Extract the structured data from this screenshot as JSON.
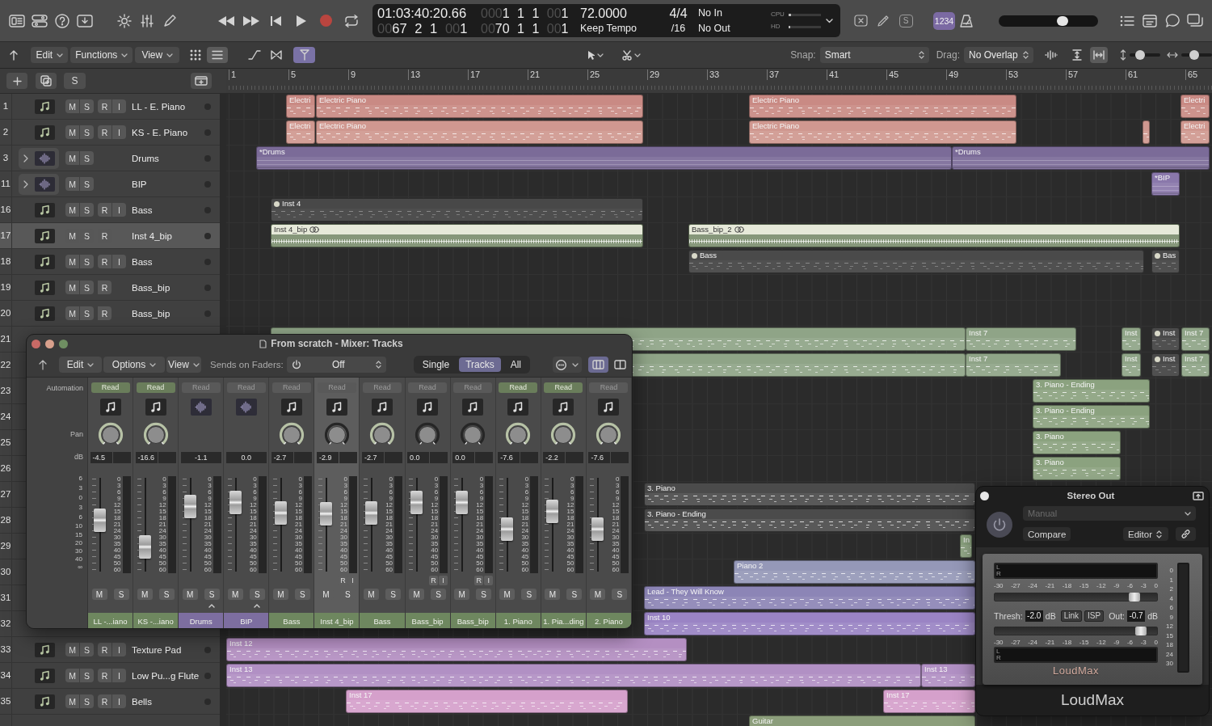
{
  "control_bar": {
    "lcd": {
      "time": "01:03:40:20.66",
      "position": "0067 2 1 001",
      "left_locator": "0001 1 1 001",
      "right_locator": "0070 1 1 001",
      "tempo": "72.0000",
      "tempo_mode": "Keep Tempo",
      "signature": "4/4",
      "division": "/16",
      "midi_in": "No In",
      "midi_out": "No Out",
      "meters": [
        {
          "label": "CPU",
          "level": 0.08
        },
        {
          "label": "HD",
          "level": 0.04
        }
      ]
    },
    "mode_button": "S",
    "count_in": {
      "label": "1234",
      "on": true
    },
    "master_volume": {
      "level": 0.66
    }
  },
  "toolbar": {
    "menus": [
      "Edit",
      "Functions",
      "View"
    ],
    "view_modes": [
      {
        "kind": "grid",
        "selected": false
      },
      {
        "kind": "list",
        "selected": true
      }
    ],
    "catch": {
      "on": true
    },
    "snap": {
      "label": "Snap:",
      "value": "Smart"
    },
    "drag": {
      "label": "Drag:",
      "value": "No Overlap"
    },
    "fit_buttons": [
      {
        "kind": "vertical",
        "selected": false
      },
      {
        "kind": "horizontal",
        "selected": true
      }
    ],
    "zoom_sliders": [
      {
        "kind": "vertical",
        "level": 0.25
      },
      {
        "kind": "horizontal",
        "level": 0.4
      }
    ]
  },
  "track_header": {
    "solo": "S"
  },
  "ruler": {
    "bars": [
      "1",
      "5",
      "9",
      "13",
      "17",
      "21",
      "25",
      "29",
      "33",
      "37",
      "41",
      "45",
      "49",
      "53",
      "57",
      "61",
      "65"
    ]
  },
  "tracks": [
    {
      "number": "1",
      "name": "LL - E. Piano",
      "kind": "midi",
      "expandable": false,
      "buttons": [
        "M",
        "S",
        "R",
        "I"
      ],
      "selected": false,
      "regions": [
        {
          "name": "Electri",
          "kind": "midi",
          "color": "#c98a84",
          "muted": false,
          "selected": false,
          "linked": false
        },
        {
          "name": "Electric Piano",
          "kind": "midi",
          "color": "#c98a84",
          "muted": false,
          "selected": false,
          "linked": false
        },
        {
          "name": "Electric Piano",
          "kind": "midi",
          "color": "#c98a84",
          "muted": false,
          "selected": false,
          "linked": false
        },
        {
          "name": "Electri",
          "kind": "midi",
          "color": "#c98a84",
          "muted": false,
          "selected": false,
          "linked": false
        }
      ]
    },
    {
      "number": "2",
      "name": "KS - E. Piano",
      "kind": "midi",
      "expandable": false,
      "buttons": [
        "M",
        "S",
        "R",
        "I"
      ],
      "selected": false,
      "regions": [
        {
          "name": "Electri",
          "kind": "midi",
          "color": "#d09890",
          "muted": false,
          "selected": false,
          "linked": false
        },
        {
          "name": "Electric Piano",
          "kind": "midi",
          "color": "#d09890",
          "muted": false,
          "selected": false,
          "linked": false
        },
        {
          "name": "Electric Piano",
          "kind": "midi",
          "color": "#d09890",
          "muted": false,
          "selected": false,
          "linked": false
        },
        {
          "kind": "midi",
          "color": "#d09890",
          "muted": false,
          "selected": false,
          "linked": false
        },
        {
          "name": "Electri",
          "kind": "midi",
          "color": "#d09890",
          "muted": false,
          "selected": false,
          "linked": false
        }
      ]
    },
    {
      "number": "3",
      "name": "Drums",
      "kind": "audio",
      "expandable": true,
      "buttons": [
        "M",
        "S"
      ],
      "selected": false,
      "regions": [
        {
          "name": "*Drums",
          "kind": "pattern",
          "color": "#7b6b98",
          "muted": false,
          "selected": false,
          "linked": false
        },
        {
          "name": "*Drums",
          "kind": "pattern",
          "color": "#7b6b98",
          "muted": false,
          "selected": false,
          "linked": false
        }
      ]
    },
    {
      "number": "11",
      "name": "BIP",
      "kind": "audio",
      "expandable": true,
      "buttons": [
        "M",
        "S"
      ],
      "selected": false,
      "regions": [
        {
          "name": "*BIP",
          "kind": "pattern",
          "color": "#8a78ab",
          "muted": false,
          "selected": false,
          "linked": false
        }
      ]
    },
    {
      "number": "16",
      "name": "Bass",
      "kind": "midi",
      "expandable": false,
      "buttons": [
        "M",
        "S",
        "R",
        "I"
      ],
      "selected": false,
      "regions": [
        {
          "name": "Inst 4",
          "kind": "midi",
          "color": "#484848",
          "muted": true,
          "selected": false,
          "linked": false
        }
      ]
    },
    {
      "number": "17",
      "name": "Inst 4_bip",
      "kind": "midi",
      "expandable": false,
      "buttons": [
        "M",
        "S",
        "R"
      ],
      "selected": true,
      "regions": [
        {
          "name": "Inst 4_bip",
          "kind": "audio",
          "color": "#7c8f6f",
          "muted": false,
          "selected": true,
          "linked": true
        },
        {
          "name": "Bass_bip_2",
          "kind": "audio",
          "color": "#7c8f6f",
          "muted": false,
          "selected": true,
          "linked": true
        }
      ]
    },
    {
      "number": "18",
      "name": "Bass",
      "kind": "midi",
      "expandable": false,
      "buttons": [
        "M",
        "S",
        "R",
        "I"
      ],
      "selected": false,
      "regions": [
        {
          "name": "Bass",
          "kind": "midi",
          "color": "#4a4a4a",
          "muted": true,
          "selected": false,
          "linked": false
        },
        {
          "name": "Bas",
          "kind": "midi",
          "color": "#4a4a4a",
          "muted": true,
          "selected": false,
          "linked": false
        }
      ]
    },
    {
      "number": "19",
      "name": "Bass_bip",
      "kind": "midi",
      "expandable": false,
      "buttons": [
        "M",
        "S",
        "R"
      ],
      "selected": false
    },
    {
      "number": "20",
      "name": "Bass_bip",
      "kind": "midi",
      "expandable": false,
      "buttons": [
        "M",
        "S",
        "R"
      ],
      "selected": false
    },
    {
      "number": "21",
      "selected": false,
      "regions": [
        {
          "kind": "midi",
          "color": "#8fa487",
          "muted": false,
          "selected": false,
          "linked": false
        },
        {
          "name": "Inst 7",
          "kind": "midi",
          "color": "#8fa487",
          "muted": false,
          "selected": false,
          "linked": false
        },
        {
          "name": "Inst",
          "kind": "midi",
          "color": "#8fa487",
          "muted": false,
          "selected": false,
          "linked": false
        },
        {
          "name": "Inst",
          "kind": "midi",
          "color": "#4a4a4a",
          "muted": true,
          "selected": false,
          "linked": false
        },
        {
          "name": "Inst 7",
          "kind": "midi",
          "color": "#8fa487",
          "muted": false,
          "selected": false,
          "linked": false
        }
      ]
    },
    {
      "number": "22",
      "selected": false,
      "regions": [
        {
          "kind": "midi",
          "color": "#8fa487",
          "muted": false,
          "selected": false
        },
        {
          "name": "Inst 7",
          "kind": "midi",
          "color": "#8fa487",
          "muted": false,
          "selected": false,
          "linked": false
        },
        {
          "name": "Inst",
          "kind": "midi",
          "color": "#8fa487",
          "muted": false,
          "selected": false,
          "linked": false
        },
        {
          "name": "Inst",
          "kind": "midi",
          "color": "#4a4a4a",
          "muted": true,
          "selected": false,
          "linked": false
        },
        {
          "name": "Inst 7",
          "kind": "midi",
          "color": "#8fa487",
          "muted": false,
          "selected": false,
          "linked": false
        }
      ]
    },
    {
      "number": "23",
      "selected": false,
      "regions": [
        {
          "name": "3. Piano - Ending",
          "kind": "midi",
          "color": "#8ba27f",
          "muted": false,
          "selected": false,
          "linked": false
        }
      ]
    },
    {
      "number": "24",
      "selected": false,
      "regions": [
        {
          "name": "3. Piano - Ending",
          "kind": "midi",
          "color": "#8ba27f",
          "muted": false,
          "selected": false,
          "linked": false
        }
      ]
    },
    {
      "number": "25",
      "selected": false,
      "regions": [
        {
          "name": "3. Piano",
          "kind": "midi",
          "color": "#8ba27f",
          "muted": false,
          "selected": false,
          "linked": false
        }
      ]
    },
    {
      "number": "26",
      "selected": false,
      "regions": [
        {
          "name": "3. Piano",
          "kind": "midi",
          "color": "#8ba27f",
          "muted": false,
          "selected": false,
          "linked": false
        }
      ]
    },
    {
      "number": "27",
      "selected": false,
      "regions": [
        {
          "name": "3. Piano",
          "kind": "midi",
          "color": "#4b4b4b",
          "muted": false,
          "selected": false,
          "linked": false
        }
      ]
    },
    {
      "number": "28",
      "selected": false,
      "regions": [
        {
          "name": "3. Piano - Ending",
          "kind": "midi",
          "color": "#4b4b4b",
          "muted": false,
          "selected": false,
          "linked": false
        }
      ]
    },
    {
      "number": "29",
      "selected": false,
      "regions": [
        {
          "name": "In",
          "kind": "midi",
          "color": "#8ba27f",
          "muted": false,
          "selected": false
        }
      ]
    },
    {
      "number": "30",
      "selected": false,
      "regions": [
        {
          "name": "Piano 2",
          "kind": "midi",
          "color": "#9598b8",
          "muted": false,
          "selected": false,
          "linked": false
        }
      ]
    },
    {
      "number": "31",
      "selected": false,
      "regions": [
        {
          "name": "Lead - They Will Know",
          "kind": "midi",
          "color": "#8c85b6",
          "muted": false,
          "selected": false,
          "linked": false
        }
      ]
    },
    {
      "number": "32",
      "selected": false,
      "regions": [
        {
          "name": "Inst 10",
          "kind": "midi",
          "color": "#9a84c4",
          "muted": false,
          "selected": false,
          "linked": false
        }
      ]
    },
    {
      "number": "33",
      "name": "Texture Pad",
      "kind": "midi",
      "expandable": false,
      "buttons": [
        "M",
        "S",
        "R",
        "I"
      ],
      "selected": false,
      "regions": [
        {
          "name": "Inst 12",
          "kind": "midi",
          "color": "#b48fc2",
          "muted": false,
          "selected": false,
          "linked": false
        }
      ]
    },
    {
      "number": "34",
      "name": "Low Pu...g Flute",
      "kind": "midi",
      "expandable": false,
      "buttons": [
        "M",
        "S",
        "R",
        "I"
      ],
      "selected": false,
      "regions": [
        {
          "name": "Inst 13",
          "kind": "midi",
          "color": "#b190c4",
          "muted": false,
          "selected": false,
          "linked": false
        },
        {
          "name": "Inst 13",
          "kind": "midi",
          "color": "#b190c4",
          "muted": false,
          "selected": false,
          "linked": false
        }
      ]
    },
    {
      "number": "35",
      "name": "Bells",
      "kind": "midi",
      "expandable": false,
      "buttons": [
        "M",
        "S",
        "R",
        "I"
      ],
      "selected": false,
      "regions": [
        {
          "name": "Inst 17",
          "kind": "midi",
          "color": "#d5a0cb",
          "muted": false,
          "selected": false,
          "linked": false
        },
        {
          "name": "Inst 17",
          "kind": "midi",
          "color": "#d5a0cb",
          "muted": false,
          "selected": false,
          "linked": false
        }
      ]
    },
    {
      "selected": false,
      "regions": [
        {
          "name": "Guitar",
          "kind": "midi",
          "color": "#8c9e7b",
          "muted": false,
          "selected": false,
          "linked": false
        }
      ]
    }
  ],
  "mixer": {
    "title": "From scratch - Mixer: Tracks",
    "menus": [
      "Edit",
      "Options",
      "View"
    ],
    "sends": {
      "label": "Sends on Faders:",
      "value": "Off"
    },
    "modes": [
      {
        "label": "Single",
        "selected": false
      },
      {
        "label": "Tracks",
        "selected": true
      },
      {
        "label": "All",
        "selected": false
      }
    ],
    "layout_buttons": [
      {
        "kind": "wide",
        "selected": true
      },
      {
        "kind": "narrow",
        "selected": false
      }
    ],
    "row_labels": {
      "automation": "Automation",
      "pan": "Pan",
      "volume": "dB"
    },
    "fader_scale": [
      "6",
      "3",
      "0",
      "3",
      "6",
      "10",
      "15",
      "20",
      "30",
      "40",
      "∞"
    ],
    "strips": [
      {
        "name": "LL -...iano",
        "kind": "midi",
        "automation": {
          "label": "Read",
          "on": true
        },
        "pan": {
          "kind": "ring"
        },
        "volume": "-4.5",
        "level": 0.56,
        "meter_scale": [
          "0",
          "3",
          "6",
          "9",
          "12",
          "15",
          "18",
          "21",
          "24",
          "30",
          "35",
          "40",
          "45",
          "50",
          "60"
        ],
        "buttons": [
          "M",
          "S"
        ],
        "expandable": false,
        "color": "#6e875f",
        "selected": false
      },
      {
        "name": "KS -...iano",
        "kind": "midi",
        "automation": {
          "label": "Read",
          "on": true
        },
        "pan": {
          "kind": "ring"
        },
        "volume": "-16.6",
        "level": 0.18,
        "meter_scale": [
          "0",
          "3",
          "6",
          "9",
          "12",
          "15",
          "18",
          "21",
          "24",
          "30",
          "35",
          "40",
          "45",
          "50",
          "60"
        ],
        "buttons": [
          "M",
          "S"
        ],
        "expandable": false,
        "color": "#6e875f",
        "selected": false
      },
      {
        "name": "Drums",
        "kind": "audio",
        "automation": {
          "label": "Read",
          "on": false
        },
        "volume": "-1.1",
        "level": 0.76,
        "meter_scale": [
          "0",
          "3",
          "6",
          "9",
          "12",
          "15",
          "18",
          "21",
          "24",
          "30",
          "35",
          "40",
          "45",
          "50",
          "60"
        ],
        "buttons": [
          "M",
          "S"
        ],
        "expandable": true,
        "color": "#7d6ea0",
        "selected": false
      },
      {
        "name": "BIP",
        "kind": "audio",
        "automation": {
          "label": "Read",
          "on": false
        },
        "volume": "0.0",
        "level": 0.82,
        "meter_scale": [
          "0",
          "3",
          "6",
          "9",
          "12",
          "15",
          "18",
          "21",
          "24",
          "30",
          "35",
          "40",
          "45",
          "50",
          "60"
        ],
        "buttons": [
          "M",
          "S"
        ],
        "expandable": true,
        "color": "#7d6ea0",
        "selected": false
      },
      {
        "name": "Bass",
        "kind": "midi",
        "automation": {
          "label": "Read",
          "on": false
        },
        "pan": {
          "kind": "ring"
        },
        "volume": "-2.7",
        "level": 0.67,
        "meter_scale": [
          "0",
          "3",
          "6",
          "9",
          "12",
          "15",
          "18",
          "21",
          "24",
          "30",
          "35",
          "40",
          "45",
          "50",
          "60"
        ],
        "buttons": [
          "M",
          "S"
        ],
        "expandable": false,
        "color": "#6e875f",
        "selected": false
      },
      {
        "name": "Inst 4_bip",
        "kind": "midi",
        "automation": {
          "label": "Read",
          "on": false
        },
        "pan": {
          "kind": "plain"
        },
        "volume": "-2.9",
        "level": 0.65,
        "meter_scale": [
          "0",
          "3",
          "6",
          "9",
          "12",
          "15",
          "18",
          "21",
          "24",
          "30",
          "35",
          "40",
          "45",
          "50",
          "60"
        ],
        "input_buttons": [
          "R",
          "I"
        ],
        "buttons": [
          "M",
          "S"
        ],
        "expandable": false,
        "color": "#6e875f",
        "selected": true
      },
      {
        "name": "Bass",
        "kind": "midi",
        "automation": {
          "label": "Read",
          "on": false
        },
        "pan": {
          "kind": "ring"
        },
        "volume": "-2.7",
        "level": 0.67,
        "meter_scale": [
          "0",
          "3",
          "6",
          "9",
          "12",
          "15",
          "18",
          "21",
          "24",
          "30",
          "35",
          "40",
          "45",
          "50",
          "60"
        ],
        "buttons": [
          "M",
          "S"
        ],
        "expandable": false,
        "color": "#6e875f",
        "selected": false
      },
      {
        "name": "Bass_bip",
        "kind": "midi",
        "automation": {
          "label": "Read",
          "on": false
        },
        "pan": {
          "kind": "plain"
        },
        "volume": "0.0",
        "level": 0.82,
        "meter_scale": [
          "0",
          "3",
          "6",
          "9",
          "12",
          "15",
          "18",
          "21",
          "24",
          "30",
          "35",
          "40",
          "45",
          "50",
          "60"
        ],
        "input_buttons": [
          "R",
          "I"
        ],
        "buttons": [
          "M",
          "S"
        ],
        "expandable": false,
        "color": "#6e875f",
        "selected": false
      },
      {
        "name": "Bass_bip",
        "kind": "midi",
        "automation": {
          "label": "Read",
          "on": false
        },
        "pan": {
          "kind": "plain"
        },
        "volume": "0.0",
        "level": 0.82,
        "meter_scale": [
          "0",
          "3",
          "6",
          "9",
          "12",
          "15",
          "18",
          "21",
          "24",
          "30",
          "35",
          "40",
          "45",
          "50",
          "60"
        ],
        "input_buttons": [
          "R",
          "I"
        ],
        "buttons": [
          "M",
          "S"
        ],
        "expandable": false,
        "color": "#6e875f",
        "selected": false
      },
      {
        "name": "1. Piano",
        "kind": "midi",
        "automation": {
          "label": "Read",
          "on": true
        },
        "pan": {
          "kind": "ring"
        },
        "volume": "-7.6",
        "level": 0.44,
        "meter_scale": [
          "0",
          "3",
          "6",
          "9",
          "12",
          "15",
          "18",
          "21",
          "24",
          "30",
          "35",
          "40",
          "45",
          "50",
          "60"
        ],
        "buttons": [
          "M",
          "S"
        ],
        "expandable": false,
        "color": "#6e875f",
        "selected": false
      },
      {
        "name": "1. Pia...ding",
        "kind": "midi",
        "automation": {
          "label": "Read",
          "on": true
        },
        "pan": {
          "kind": "ring"
        },
        "volume": "-2.2",
        "level": 0.69,
        "meter_scale": [
          "0",
          "3",
          "6",
          "9",
          "12",
          "15",
          "18",
          "21",
          "24",
          "30",
          "35",
          "40",
          "45",
          "50",
          "60"
        ],
        "buttons": [
          "M",
          "S"
        ],
        "expandable": false,
        "color": "#6e875f",
        "selected": false
      },
      {
        "name": "2. Piano",
        "kind": "midi",
        "automation": {
          "label": "Read",
          "on": false
        },
        "pan": {
          "kind": "ring"
        },
        "volume": "-7.6",
        "level": 0.44,
        "meter_scale": [
          "0",
          "3",
          "6",
          "9",
          "12",
          "15",
          "18",
          "21",
          "24",
          "30",
          "35",
          "40",
          "45",
          "50",
          "60"
        ],
        "buttons": [
          "M",
          "S"
        ],
        "expandable": false,
        "color": "#6e875f",
        "selected": false
      }
    ]
  },
  "plugin": {
    "title": "Stereo Out",
    "preset": {
      "value": "Manual",
      "disabled": true
    },
    "compare": "Compare",
    "view": "Editor",
    "loudmax": {
      "top_meter": [
        "L",
        "R"
      ],
      "top_scale": [
        "-30",
        "-27",
        "-24",
        "-21",
        "-18",
        "-15",
        "-12",
        "-9",
        "-6",
        "-3",
        "0"
      ],
      "threshold": {
        "level": 0.89
      },
      "controls": {
        "thresh_label": "Thresh:",
        "thresh_value": "-2.0",
        "thresh_unit": "dB",
        "link": "Link",
        "isp": "ISP",
        "out_label": "Out:",
        "out_value": "-0.7",
        "out_unit": "dB"
      },
      "output": {
        "level": 0.93
      },
      "bottom_scale": [
        "-30",
        "-27",
        "-24",
        "-21",
        "-18",
        "-15",
        "-12",
        "-9",
        "-6",
        "-3",
        "0"
      ],
      "bottom_meter": [
        "L",
        "R"
      ],
      "logo": "LoudMax",
      "side_scale": [
        "0",
        "1",
        "2",
        "4",
        "6",
        "9",
        "12",
        "15",
        "18",
        "24",
        "30"
      ]
    },
    "footer": "LoudMax"
  }
}
